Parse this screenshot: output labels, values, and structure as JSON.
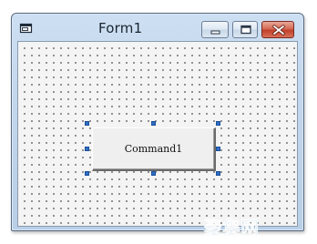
{
  "window": {
    "title": "Form1"
  },
  "form": {
    "grid": "dotted"
  },
  "command_button": {
    "label": "Command1",
    "selected": true
  },
  "watermark": {
    "text": "聚集网",
    "color": "#3aa0e8"
  }
}
